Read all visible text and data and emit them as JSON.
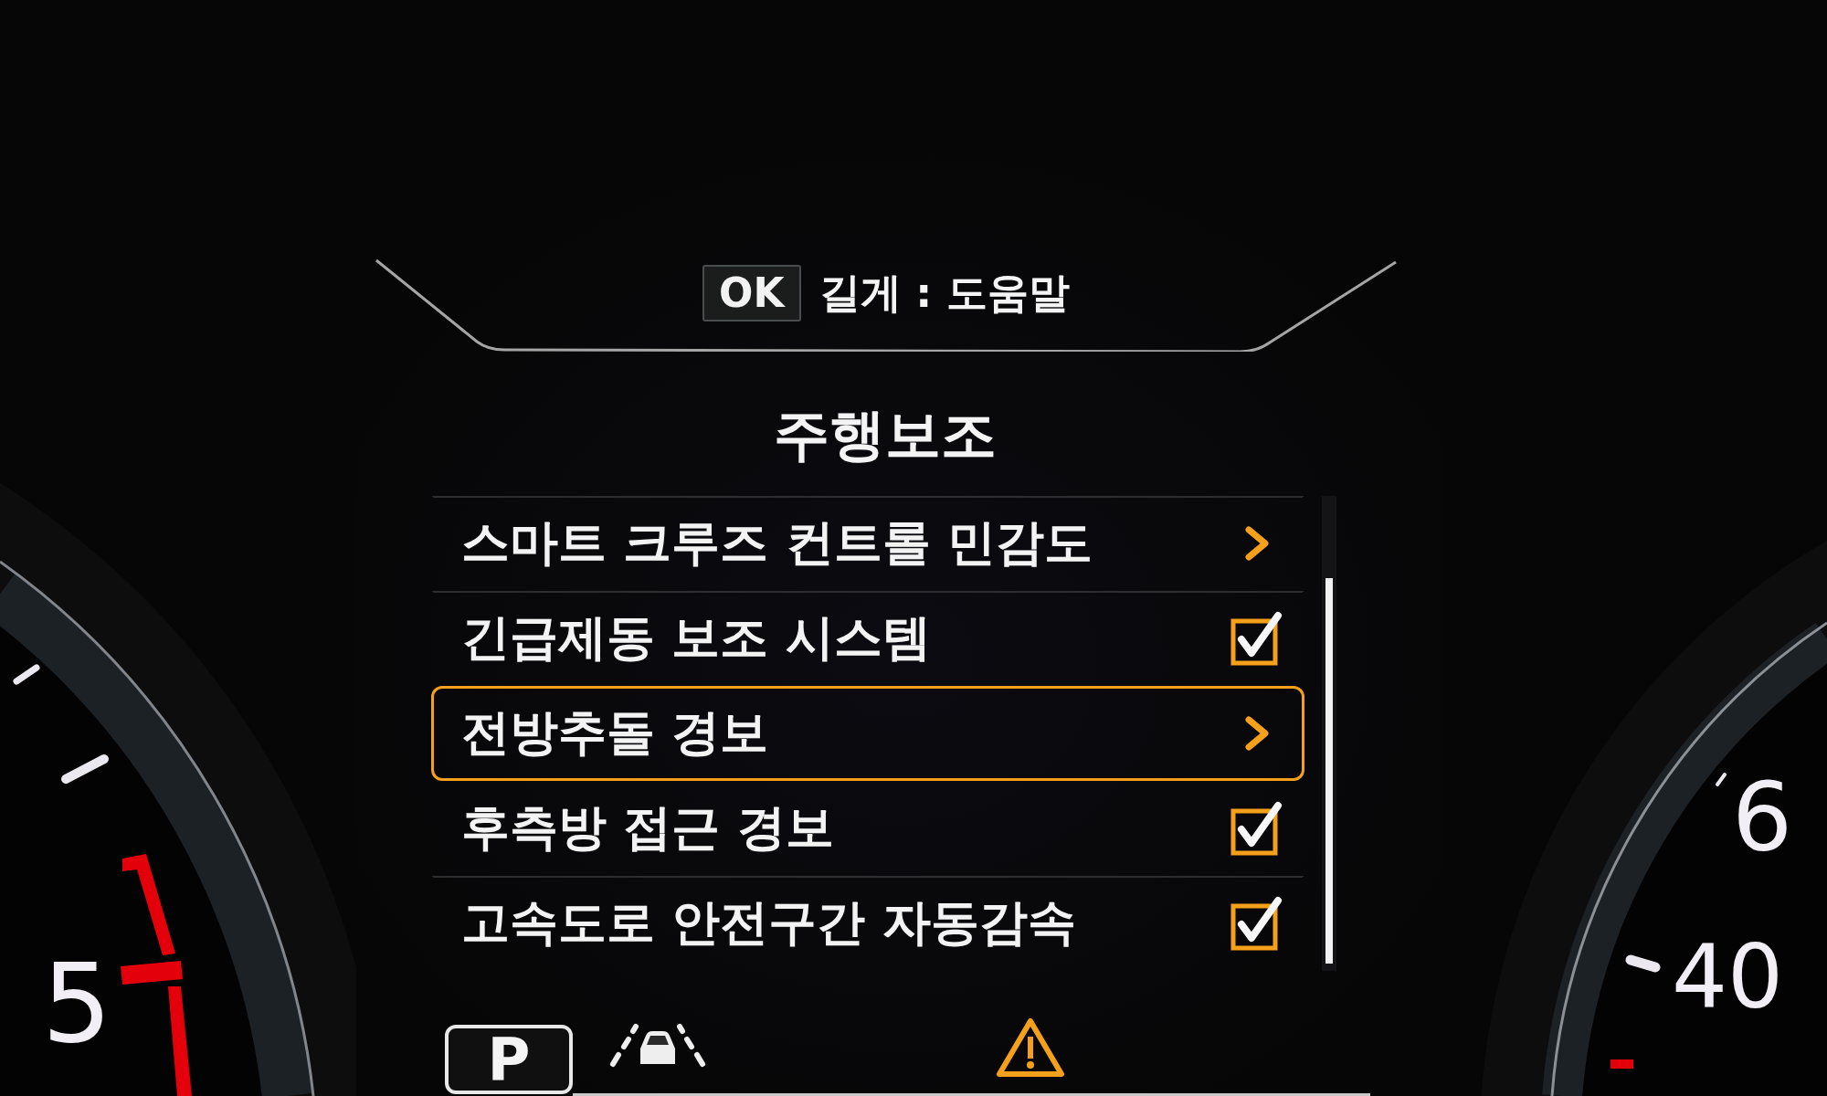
{
  "header": {
    "key": "OK",
    "hint": "길게 : 도움말"
  },
  "title": "주행보조",
  "items": [
    {
      "label": "스마트 크루즈 컨트롤 민감도",
      "kind": "submenu",
      "selected": false
    },
    {
      "label": "긴급제동 보조 시스템",
      "kind": "toggle",
      "checked": true,
      "selected": false
    },
    {
      "label": "전방추돌 경보",
      "kind": "submenu",
      "selected": true
    },
    {
      "label": "후측방 접근 경보",
      "kind": "toggle",
      "checked": true,
      "selected": false
    },
    {
      "label": "고속도로 안전구간 자동감속",
      "kind": "toggle",
      "checked": true,
      "selected": false
    }
  ],
  "status_bar": {
    "gear": "P"
  },
  "left_gauge": {
    "labels": [
      "5"
    ]
  },
  "right_gauge": {
    "labels": [
      "6",
      "40"
    ]
  }
}
